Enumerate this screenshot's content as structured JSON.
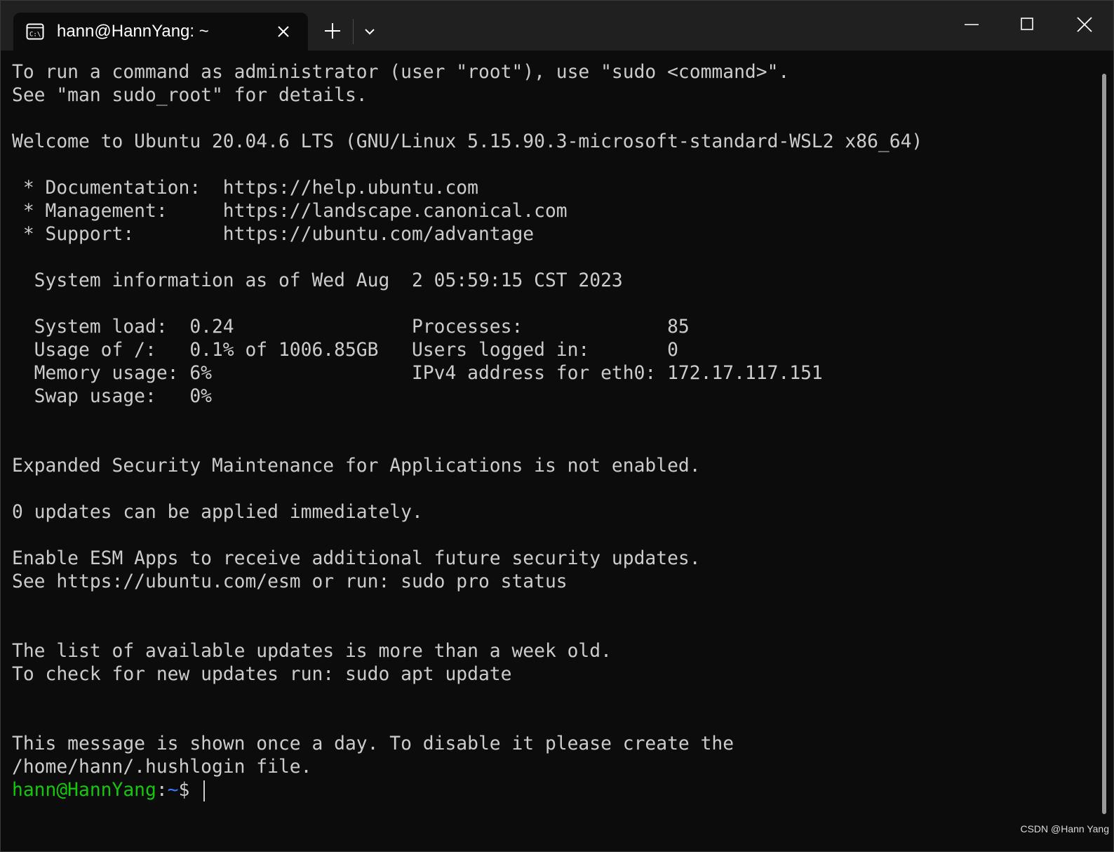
{
  "tab": {
    "title": "hann@HannYang: ~",
    "icon": "terminal-icon"
  },
  "titlebar": {
    "new_tab_icon": "plus-icon",
    "dropdown_icon": "chevron-down-icon",
    "minimize_icon": "minimize-icon",
    "maximize_icon": "maximize-icon",
    "close_icon": "close-icon"
  },
  "terminal": {
    "lines": [
      "To run a command as administrator (user \"root\"), use \"sudo <command>\".",
      "See \"man sudo_root\" for details.",
      "",
      "Welcome to Ubuntu 20.04.6 LTS (GNU/Linux 5.15.90.3-microsoft-standard-WSL2 x86_64)",
      "",
      " * Documentation:  https://help.ubuntu.com",
      " * Management:     https://landscape.canonical.com",
      " * Support:        https://ubuntu.com/advantage",
      "",
      "  System information as of Wed Aug  2 05:59:15 CST 2023",
      "",
      "  System load:  0.24                Processes:             85",
      "  Usage of /:   0.1% of 1006.85GB   Users logged in:       0",
      "  Memory usage: 6%                  IPv4 address for eth0: 172.17.117.151",
      "  Swap usage:   0%",
      "",
      "",
      "Expanded Security Maintenance for Applications is not enabled.",
      "",
      "0 updates can be applied immediately.",
      "",
      "Enable ESM Apps to receive additional future security updates.",
      "See https://ubuntu.com/esm or run: sudo pro status",
      "",
      "",
      "The list of available updates is more than a week old.",
      "To check for new updates run: sudo apt update",
      "",
      "",
      "This message is shown once a day. To disable it please create the",
      "/home/hann/.hushlogin file."
    ],
    "prompt": {
      "user_host": "hann@HannYang",
      "colon": ":",
      "path": "~",
      "symbol": "$ "
    }
  },
  "watermark": "CSDN @Hann Yang",
  "colors": {
    "background": "#0c0c0c",
    "titlebar": "#202020",
    "text": "#cccccc",
    "prompt_user": "#16c60c",
    "prompt_path": "#3b78ff"
  }
}
